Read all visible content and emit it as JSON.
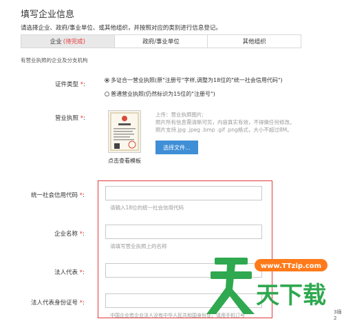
{
  "page": {
    "title": "填写企业信息",
    "instruction": "请选择企业、政府/事业单位、或其他组织，并按照对应的类别进行信息登记。",
    "subnote": "有营业执照的企业及分支机构"
  },
  "tabs": [
    {
      "label": "企业",
      "status": "(待完成)"
    },
    {
      "label": "政府/事业单位"
    },
    {
      "label": "其他组织"
    }
  ],
  "required_mark": "*",
  "colon": ":",
  "cert_type": {
    "label": "证件类型",
    "options": [
      "多证合一营业执照(原\"注册号\"字样,调整为18位的\"统一社会信用代码\")",
      "普通营业执照(仍然标识为15位的\"注册号\")"
    ],
    "selected": 0
  },
  "license": {
    "label": "营业执照",
    "thumb_caption": "点击查看模板",
    "hint_lines": [
      "上传：营业执照图片;",
      "照片所有信息需清晰可见，内容真实有效，不得做任何修改。",
      "照片支持.jpg .jpeg .bmp .gif .png格式，大小不超过8M。"
    ],
    "button": "选择文件..."
  },
  "fields": [
    {
      "label": "统一社会信用代码",
      "value": "",
      "hint": "请输入18位的统一社会信用代码"
    },
    {
      "label": "企业名称",
      "value": "",
      "hint": "请填写营业执照上的名称"
    },
    {
      "label": "法人代表",
      "value": "",
      "hint": ""
    },
    {
      "label": "法人代表身份证号",
      "value": "",
      "hint": "中国企业若企业法人没有中华人民共和国身份证，请用手机订号"
    }
  ],
  "watermark": {
    "url": "www.TTzip.com",
    "name": "天下载",
    "mark": "天"
  },
  "edge_text": "3插2",
  "colors": {
    "accent": "#e4393c",
    "button": "#3f8ed6",
    "redbox": "#e03a3a",
    "watermark": "#2fa84f"
  }
}
